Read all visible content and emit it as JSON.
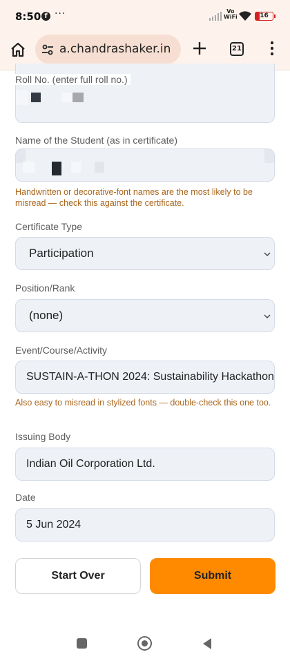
{
  "status_bar": {
    "time": "8:50",
    "overflow": "···",
    "network_label_top": "Vo",
    "network_label_bottom": "WiFi",
    "battery": "16",
    "icons": [
      "facebook-icon",
      "signal-icon",
      "wifi-icon",
      "battery-icon"
    ]
  },
  "browser": {
    "url": "a.chandrashaker.in",
    "tab_count": "21",
    "icons": [
      "home-icon",
      "site-settings-icon",
      "new-tab-plus-icon",
      "tab-switcher-icon",
      "more-menu-icon"
    ]
  },
  "form": {
    "roll_no": {
      "label": "Roll No. (enter full roll no.)",
      "value_redacted": true
    },
    "student_name": {
      "label": "Name of the Student (as in certificate)",
      "value_redacted": true,
      "hint": "Handwritten or decorative-font names are the most likely to be misread — check this against the certificate."
    },
    "certificate_type": {
      "label": "Certificate Type",
      "selected": "Participation"
    },
    "position_rank": {
      "label": "Position/Rank",
      "selected": "(none)"
    },
    "event": {
      "label": "Event/Course/Activity",
      "value": "SUSTAIN-A-THON 2024: Sustainability Hackathon",
      "hint": "Also easy to misread in stylized fonts — double-check this one too."
    },
    "issuing_body": {
      "label": "Issuing Body",
      "value": "Indian Oil Corporation Ltd."
    },
    "date": {
      "label": "Date",
      "value": "5 Jun 2024"
    }
  },
  "actions": {
    "start_over": "Start Over",
    "submit": "Submit"
  },
  "colors": {
    "accent": "#ff8a00",
    "hint": "#a9651b",
    "chrome_bg": "#fdf3ec",
    "field_bg": "#eef1f6"
  }
}
